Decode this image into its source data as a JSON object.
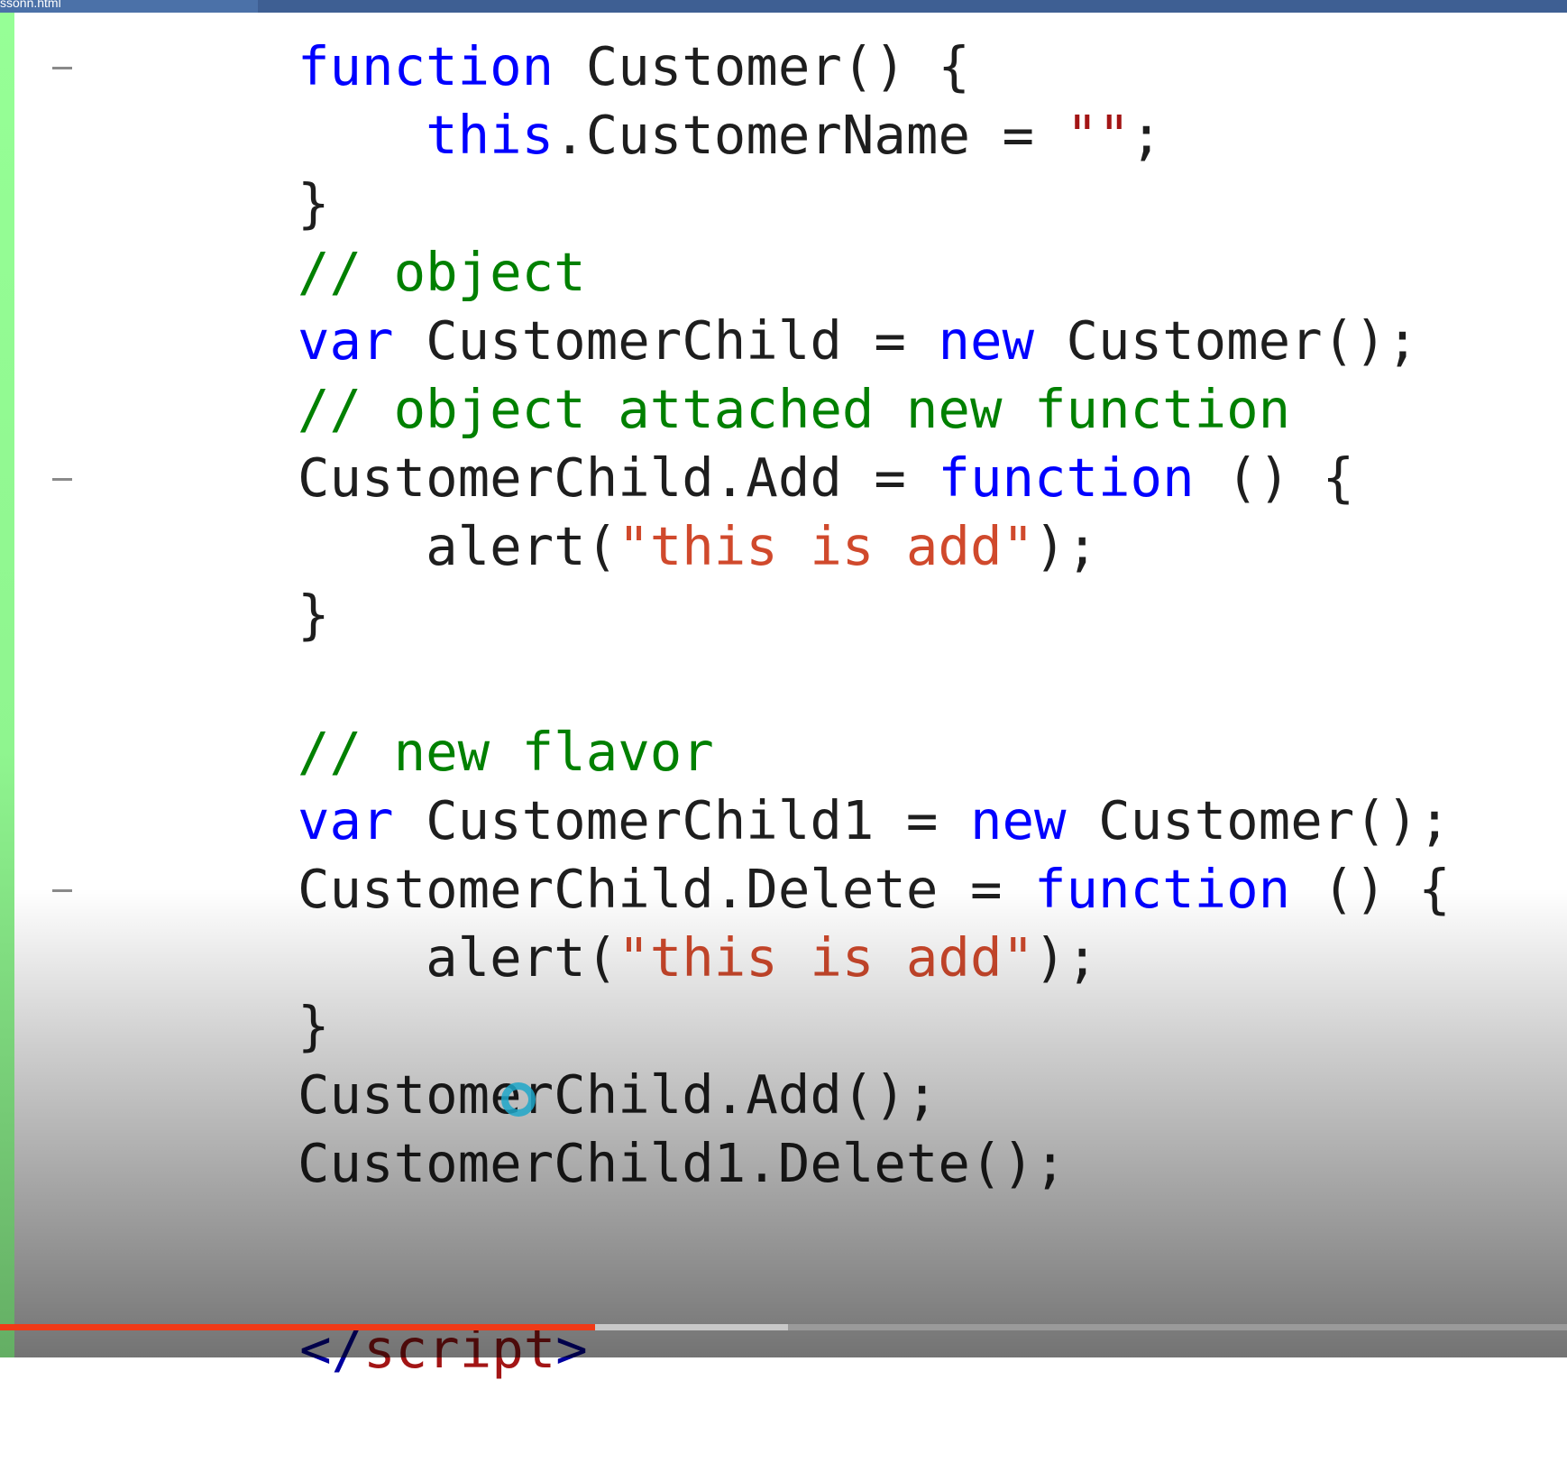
{
  "window": {
    "tab_title": "ssonn.html"
  },
  "colors": {
    "keyword": "#0000ff",
    "comment": "#008000",
    "string": "#a31515",
    "identifier": "#1e1e1e",
    "progress": "#f03a17"
  },
  "code": {
    "lines": [
      {
        "fold": true,
        "tokens": [
          {
            "t": "function",
            "c": "kw"
          },
          {
            "t": " Customer() {",
            "c": ""
          }
        ]
      },
      {
        "fold": false,
        "tokens": [
          {
            "t": "    ",
            "c": ""
          },
          {
            "t": "this",
            "c": "kw"
          },
          {
            "t": ".CustomerName = ",
            "c": ""
          },
          {
            "t": "\"\"",
            "c": "st"
          },
          {
            "t": ";",
            "c": ""
          }
        ]
      },
      {
        "fold": false,
        "tokens": [
          {
            "t": "}",
            "c": ""
          }
        ]
      },
      {
        "fold": false,
        "tokens": [
          {
            "t": "// object",
            "c": "cm"
          }
        ]
      },
      {
        "fold": false,
        "tokens": [
          {
            "t": "var",
            "c": "kw"
          },
          {
            "t": " CustomerChild = ",
            "c": ""
          },
          {
            "t": "new",
            "c": "kw"
          },
          {
            "t": " Customer();",
            "c": ""
          }
        ]
      },
      {
        "fold": false,
        "tokens": [
          {
            "t": "// object attached new function",
            "c": "cm"
          }
        ]
      },
      {
        "fold": true,
        "tokens": [
          {
            "t": "CustomerChild.Add = ",
            "c": ""
          },
          {
            "t": "function",
            "c": "kw"
          },
          {
            "t": " () {",
            "c": ""
          }
        ]
      },
      {
        "fold": false,
        "tokens": [
          {
            "t": "    alert(",
            "c": ""
          },
          {
            "t": "\"this is add\"",
            "c": "st"
          },
          {
            "t": ");",
            "c": ""
          }
        ]
      },
      {
        "fold": false,
        "tokens": [
          {
            "t": "}",
            "c": ""
          }
        ]
      },
      {
        "fold": false,
        "tokens": []
      },
      {
        "fold": false,
        "tokens": [
          {
            "t": "// new flavor",
            "c": "cm"
          }
        ]
      },
      {
        "fold": false,
        "tokens": [
          {
            "t": "var",
            "c": "kw"
          },
          {
            "t": " CustomerChild1 = ",
            "c": ""
          },
          {
            "t": "new",
            "c": "kw"
          },
          {
            "t": " Customer();",
            "c": ""
          }
        ]
      },
      {
        "fold": true,
        "tokens": [
          {
            "t": "CustomerChild.Delete = ",
            "c": ""
          },
          {
            "t": "function",
            "c": "kw"
          },
          {
            "t": " () {",
            "c": ""
          }
        ]
      },
      {
        "fold": false,
        "tokens": [
          {
            "t": "    alert(",
            "c": ""
          },
          {
            "t": "\"this is add\"",
            "c": "st"
          },
          {
            "t": ");",
            "c": ""
          }
        ]
      },
      {
        "fold": false,
        "tokens": [
          {
            "t": "}",
            "c": ""
          }
        ]
      },
      {
        "fold": false,
        "tokens": [
          {
            "t": "CustomerChild.Add();",
            "c": ""
          }
        ]
      },
      {
        "fold": false,
        "tokens": [
          {
            "t": "CustomerChild1.Delete();",
            "c": ""
          }
        ]
      }
    ],
    "closing_tag": {
      "open": "</",
      "name": "script",
      "close": ">"
    }
  },
  "video": {
    "progress_fraction": 0.38,
    "buffered_fraction": 0.503
  }
}
